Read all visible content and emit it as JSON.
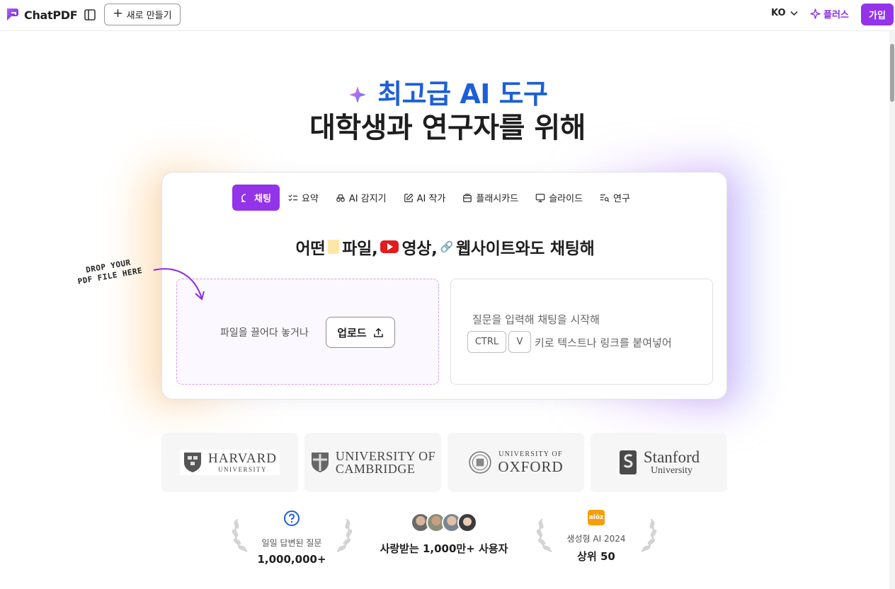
{
  "header": {
    "logo_text": "ChatPDF",
    "new_button": "새로 만들기",
    "language": "KO",
    "plus_link": "플러스",
    "signup_button": "가입"
  },
  "hero": {
    "line1": "최고급 AI 도구",
    "line2": "대학생과 연구자를 위해"
  },
  "tabs": [
    {
      "label": "채팅",
      "icon": "chat-bubble-icon"
    },
    {
      "label": "요약",
      "icon": "checklist-icon"
    },
    {
      "label": "AI 감지기",
      "icon": "detector-icon"
    },
    {
      "label": "AI 작가",
      "icon": "pencil-square-icon"
    },
    {
      "label": "플래시카드",
      "icon": "cards-icon"
    },
    {
      "label": "슬라이드",
      "icon": "presentation-icon"
    },
    {
      "label": "연구",
      "icon": "search-list-icon"
    }
  ],
  "headline": {
    "part1": "어떤",
    "part2": "파일,",
    "part3": "영상,",
    "part4": "웹사이트와도 채팅해"
  },
  "dropzone": {
    "text": "파일을 끌어다 놓거나",
    "upload_button": "업로드",
    "drop_note_line1": "DROP YOUR",
    "drop_note_line2": "PDF FILE HERE"
  },
  "chatbox": {
    "hint": "질문을 입력해 채팅을 시작해",
    "key_ctrl": "CTRL",
    "key_v": "V",
    "paste_text": "키로 텍스트나 링크를 붙여넣어"
  },
  "universities": {
    "harvard": {
      "name": "HARVARD",
      "sub": "UNIVERSITY"
    },
    "cambridge": {
      "line1": "UNIVERSITY OF",
      "line2": "CAMBRIDGE"
    },
    "oxford": {
      "line1": "UNIVERSITY OF",
      "line2": "OXFORD"
    },
    "stanford": {
      "name": "Stanford",
      "sub": "University"
    }
  },
  "stats": {
    "questions_label": "일일 답변된 질문",
    "questions_value": "1,000,000+",
    "users_text": "사랑받는 1,000만+ 사용자",
    "award_badge": "alöz",
    "award_label": "생성형 AI 2024",
    "award_value": "상위 50"
  },
  "colors": {
    "accent_purple": "#9333ea",
    "hero_blue": "#1d5fd6",
    "youtube_red": "#e11d1d"
  }
}
